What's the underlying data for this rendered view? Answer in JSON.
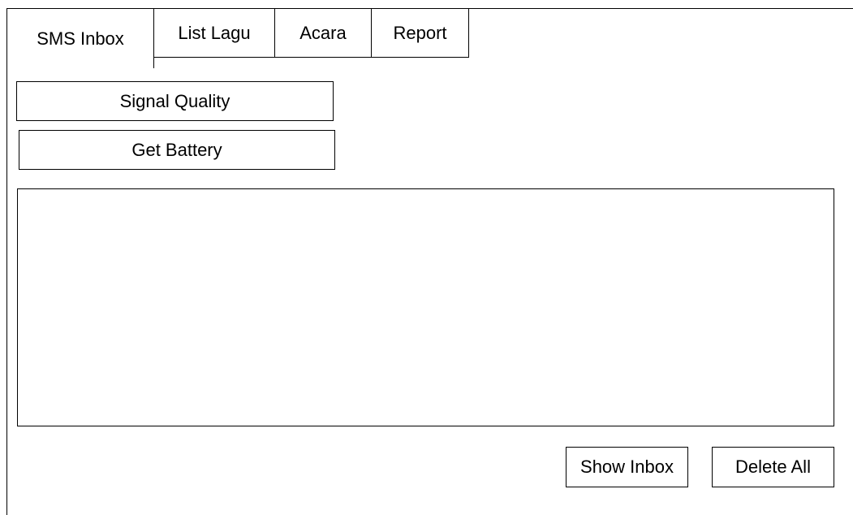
{
  "tabs": {
    "sms_inbox": "SMS Inbox",
    "list_lagu": "List Lagu",
    "acara": "Acara",
    "report": "Report"
  },
  "buttons": {
    "signal_quality": "Signal Quality",
    "get_battery": "Get Battery",
    "show_inbox": "Show Inbox",
    "delete_all": "Delete All"
  },
  "message_area": {
    "value": ""
  }
}
